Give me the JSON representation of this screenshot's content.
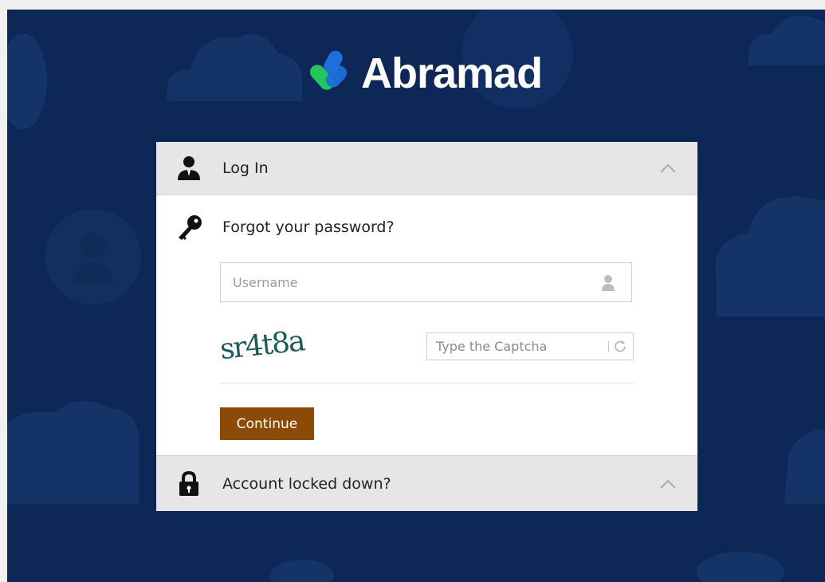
{
  "brand": {
    "name": "Abramad",
    "colors": {
      "background": "#0d2756",
      "logo_blue": "#1e6fd9",
      "logo_green": "#22c55e",
      "button": "#8b4a06"
    }
  },
  "login_section": {
    "title": "Log In",
    "icon": "user-icon",
    "expanded": true
  },
  "forgot_section": {
    "title": "Forgot your password?",
    "icon": "key-icon",
    "username_placeholder": "Username",
    "username_value": "",
    "captcha_text": "sr4t8a",
    "captcha_placeholder": "Type the Captcha",
    "captcha_value": "",
    "continue_label": "Continue"
  },
  "locked_section": {
    "title": "Account locked down?",
    "icon": "lock-icon",
    "expanded": false
  }
}
